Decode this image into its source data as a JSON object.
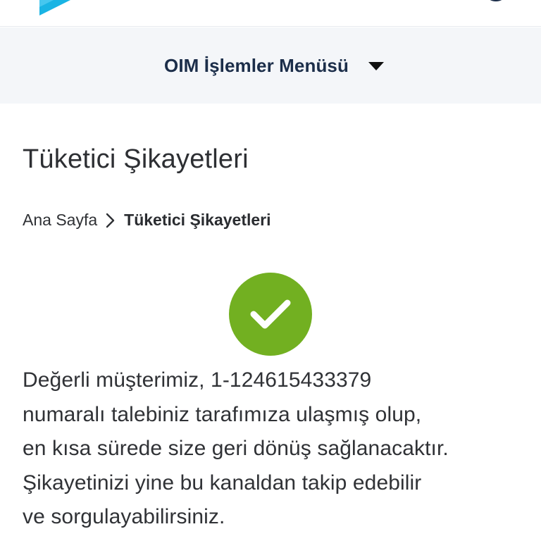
{
  "menu": {
    "label": "OIM İşlemler Menüsü",
    "icon": "caret-down-icon"
  },
  "page": {
    "title": "Tüketici Şikayetleri"
  },
  "breadcrumb": {
    "home": "Ana Sayfa",
    "separator_icon": "chevron-right-icon",
    "current": "Tüketici Şikayetleri"
  },
  "status": {
    "icon": "check-circle-icon",
    "color": "#72b021"
  },
  "message": {
    "lines": [
      "Değerli müşterimiz, 1-124615433379",
      "numaralı talebiniz tarafımıza ulaşmış olup,",
      "en kısa sürede size geri dönüş sağlanacaktır.",
      "Şikayetinizi yine bu kanaldan takip edebilir",
      "ve sorgulayabilirsiniz."
    ]
  },
  "colors": {
    "brand_logo": "#19b4e4",
    "menu_text": "#1c2e4a",
    "menu_background": "#f4f6f9",
    "success": "#72b021"
  }
}
